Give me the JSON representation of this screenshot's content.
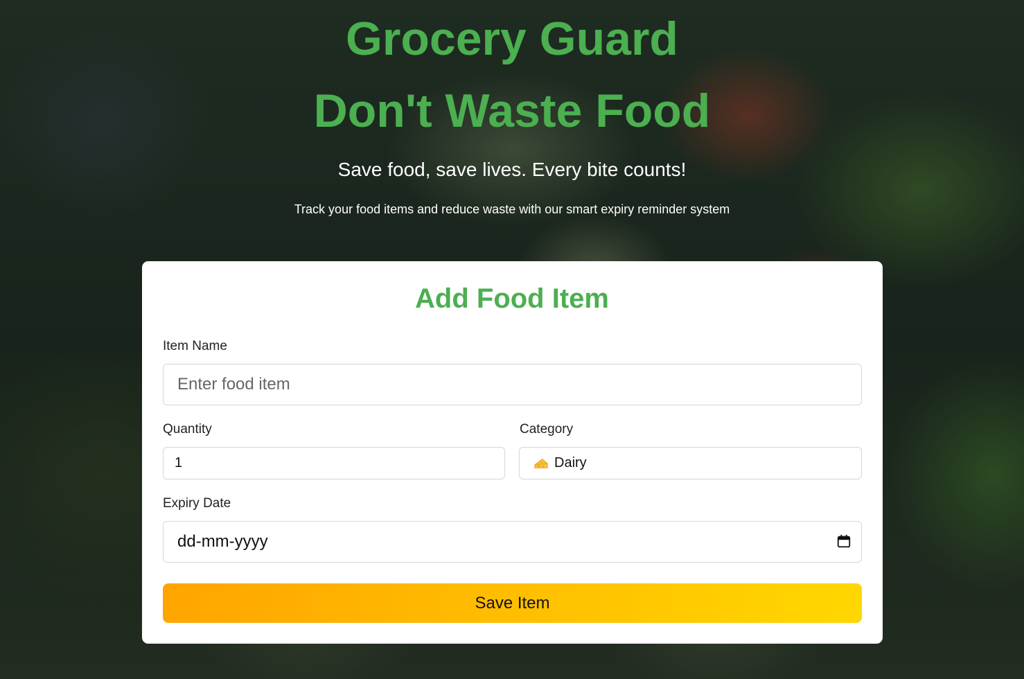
{
  "header": {
    "brand": "Grocery Guard",
    "headline": "Don't Waste Food",
    "tagline": "Save food, save lives. Every bite counts!",
    "subtext": "Track your food items and reduce waste with our smart expiry reminder system"
  },
  "form": {
    "title": "Add Food Item",
    "item_name": {
      "label": "Item Name",
      "placeholder": "Enter food item",
      "value": ""
    },
    "quantity": {
      "label": "Quantity",
      "value": "1"
    },
    "category": {
      "label": "Category",
      "icon": "cheese-icon",
      "value": "Dairy"
    },
    "expiry": {
      "label": "Expiry Date",
      "placeholder": "dd-mm-yyyy",
      "icon": "calendar-icon"
    },
    "save_label": "Save Item"
  },
  "colors": {
    "brand_green": "#4caf50",
    "button_gradient_start": "#ffa500",
    "button_gradient_end": "#ffd700"
  }
}
